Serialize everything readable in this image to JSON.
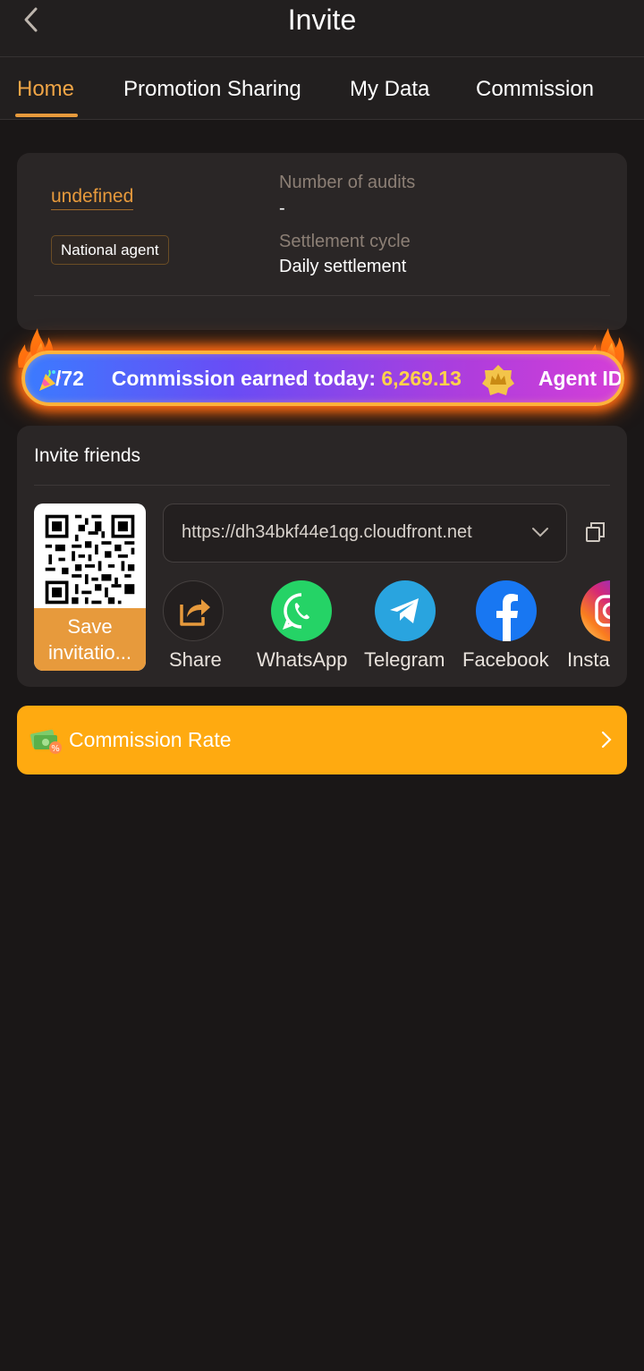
{
  "header": {
    "title": "Invite"
  },
  "tabs": [
    {
      "label": "Home",
      "active": true
    },
    {
      "label": "Promotion Sharing",
      "active": false
    },
    {
      "label": "My Data",
      "active": false
    },
    {
      "label": "Commission",
      "active": false
    }
  ],
  "profile": {
    "username": "undefined",
    "agent_type": "National agent",
    "audits_label": "Number of audits",
    "audits_value": "-",
    "settlement_label": "Settlement cycle",
    "settlement_value": "Daily settlement"
  },
  "marquee": {
    "prefix": "/72",
    "commission_label": "Commission earned today: ",
    "commission_amount": "6,269.13",
    "agent_id_label": "Agent ID:"
  },
  "invite": {
    "title": "Invite friends",
    "save_label": "Save invitatio...",
    "link": "https://dh34bkf44e1qg.cloudfront.net",
    "share_options": [
      {
        "label": "Share",
        "icon": "share-icon"
      },
      {
        "label": "WhatsApp",
        "icon": "whatsapp-icon"
      },
      {
        "label": "Telegram",
        "icon": "telegram-icon"
      },
      {
        "label": "Facebook",
        "icon": "facebook-icon"
      },
      {
        "label": "Instagr",
        "icon": "instagram-icon"
      }
    ]
  },
  "commission_rate": {
    "label": "Commission Rate"
  },
  "colors": {
    "accent": "#e79a3c",
    "background": "#1a1717",
    "card": "#2a2626",
    "commission_rate_bg": "#ffaa10",
    "amount": "#ffd24a"
  }
}
